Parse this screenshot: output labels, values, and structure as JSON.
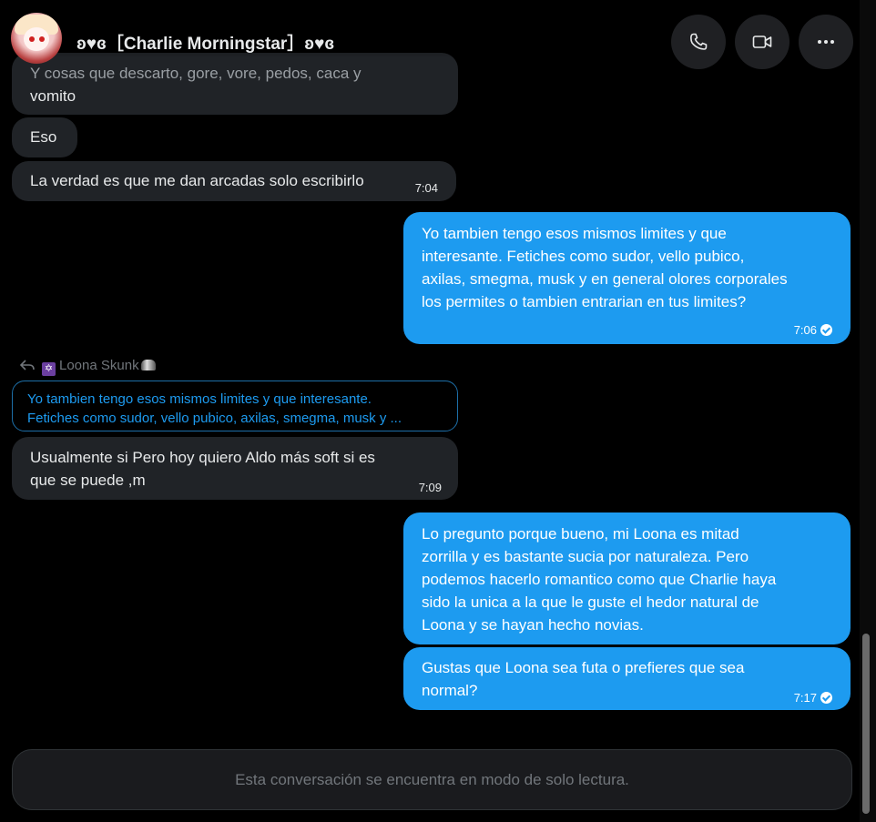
{
  "header": {
    "title": "ʚ♥ɞ［Charlie Morningstar］ʚ♥ɞ",
    "buttons": [
      "phone-icon",
      "video-icon",
      "more-icon"
    ]
  },
  "messages": {
    "m1_line1": "Y cosas que descarto, gore, vore, pedos, caca y",
    "m1_line2": "vomito",
    "m2": "Eso",
    "m3": "La verdad es que me dan arcadas solo escribirlo",
    "m3_time": "7:04",
    "m4_lines": [
      "Yo tambien tengo esos mismos limites y que",
      "interesante. Fetiches como sudor, vello pubico,",
      "axilas, smegma, musk y en general olores corporales",
      "los permites o tambien entrarian en tus limites?"
    ],
    "m4_time": "7:06",
    "reply_label": "Loona Skunk",
    "quote_line1": "Yo tambien tengo esos mismos limites y que interesante.",
    "quote_line2": "Fetiches como sudor, vello pubico, axilas, smegma, musk y ...",
    "m5_line1": "Usualmente si Pero hoy quiero Aldo más soft si es",
    "m5_line2": "que se puede ,m",
    "m5_time": "7:09",
    "m6_lines": [
      "Lo pregunto porque bueno, mi Loona es mitad",
      "zorrilla y es bastante sucia por naturaleza. Pero",
      "podemos hacerlo romantico como que Charlie haya",
      "sido la unica a la que le guste el hedor natural de",
      "Loona y se hayan hecho novias."
    ],
    "m7_line1": "Gustas que Loona sea futa o prefieres que sea",
    "m7_line2": "normal?",
    "m7_time": "7:17"
  },
  "composer": {
    "placeholder": "Esta conversación se encuentra en modo de solo lectura."
  },
  "colors": {
    "background": "#000000",
    "incoming_bubble": "#202327",
    "outgoing_bubble": "#1d9bf0",
    "quote_text": "#1d9bf0"
  }
}
